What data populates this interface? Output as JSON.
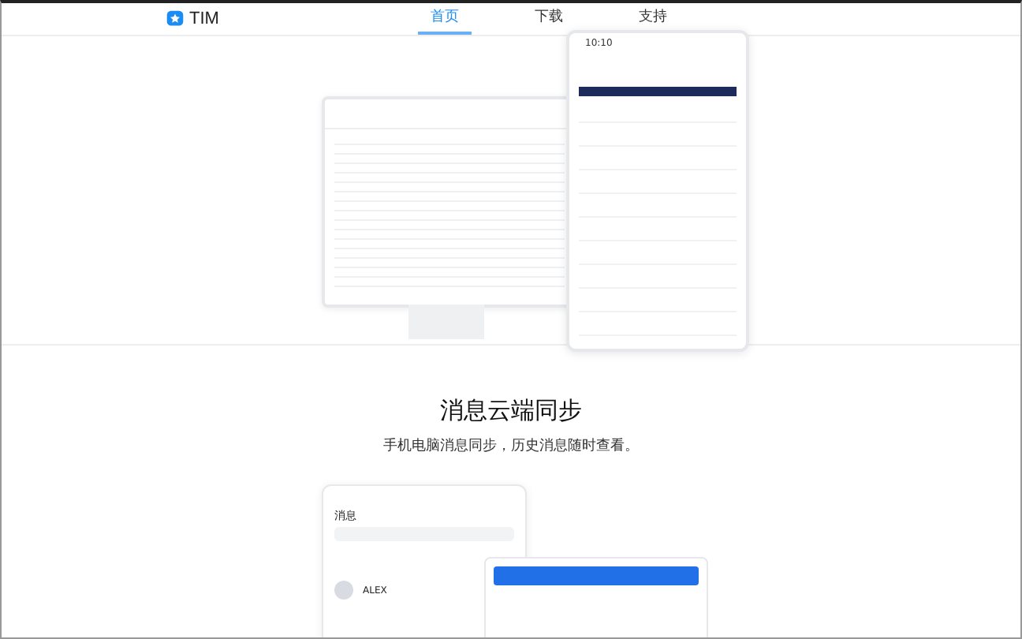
{
  "header": {
    "logo": "TIM",
    "nav": [
      {
        "label": "首页",
        "selected": true
      },
      {
        "label": "下载",
        "selected": false
      },
      {
        "label": "支持",
        "selected": false
      }
    ]
  },
  "hero": {
    "phone_time": "10:10"
  },
  "feature": {
    "title": "消息云端同步",
    "subtitle": "手机电脑消息同步，历史消息随时查看。"
  },
  "preview": {
    "title": "消息",
    "contact": "ALEX"
  }
}
